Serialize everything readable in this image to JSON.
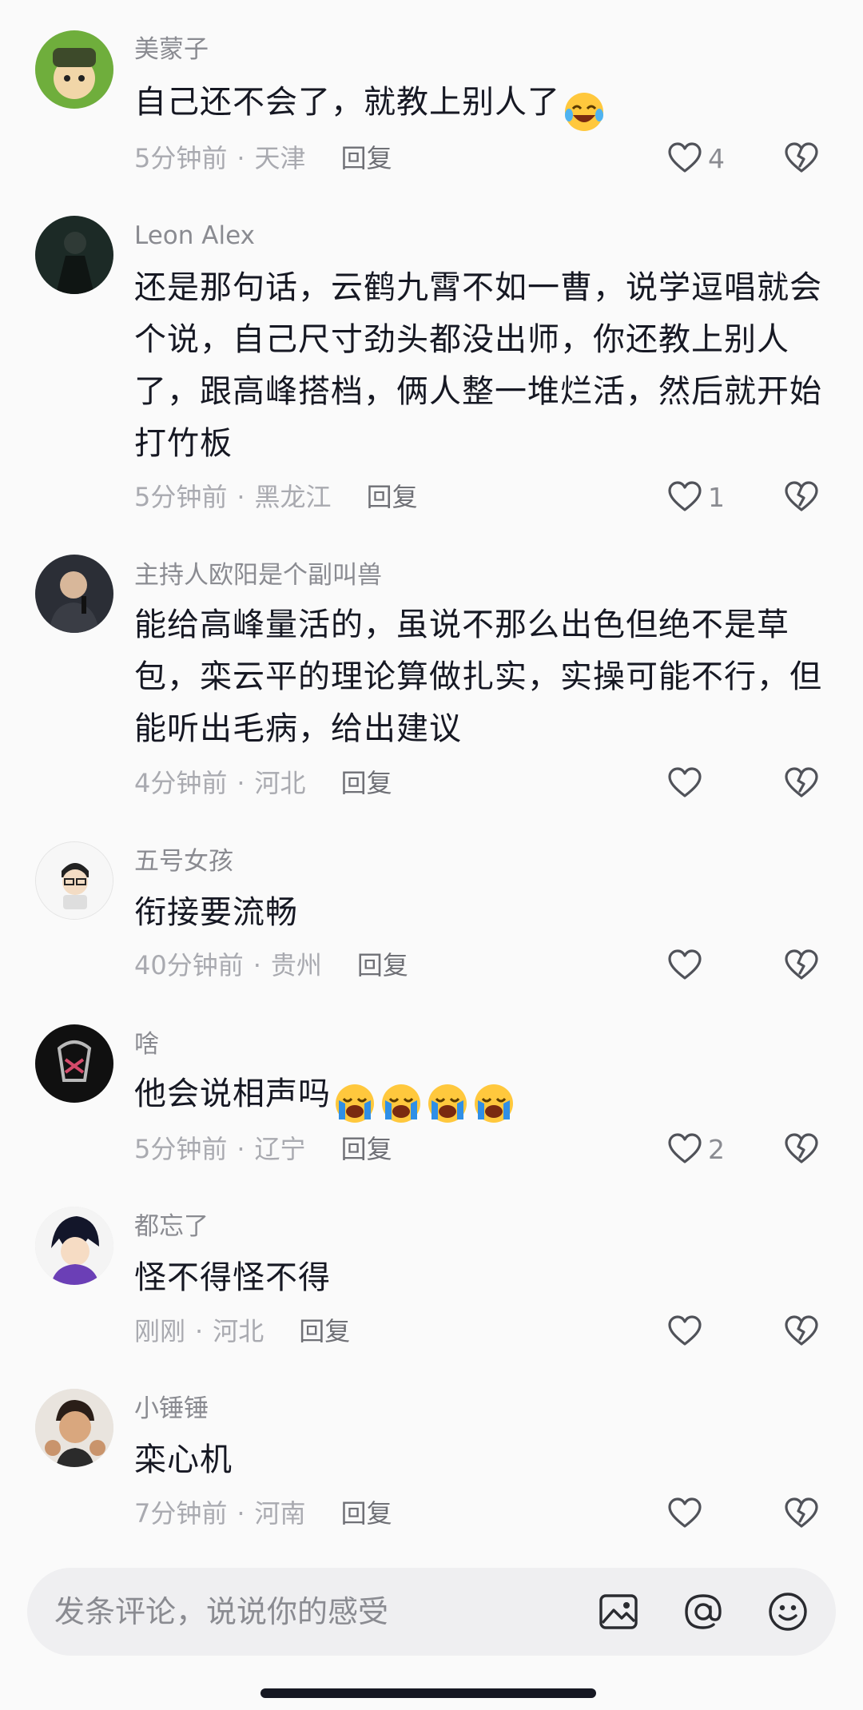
{
  "comments": [
    {
      "username": "美蒙子",
      "lines": [
        "自己还不会了，就教上别人了"
      ],
      "emoji_count": 1,
      "time": "5分钟前",
      "location": "天津",
      "reply": "回复",
      "likes": "4"
    },
    {
      "username": "Leon Alex",
      "lines": [
        "还是那句话，云鹤九霄不如一曹，说学逗唱就会",
        "个说，自己尺寸劲头都没出师，你还教上别人",
        "了，跟高峰搭档，俩人整一堆烂活，然后就开始",
        "打竹板"
      ],
      "emoji_count": 0,
      "time": "5分钟前",
      "location": "黑龙江",
      "reply": "回复",
      "likes": "1"
    },
    {
      "username": "主持人欧阳是个副叫兽",
      "lines": [
        "能给高峰量活的，虽说不那么出色但绝不是草",
        "包，栾云平的理论算做扎实，实操可能不行，但",
        "能听出毛病，给出建议"
      ],
      "emoji_count": 0,
      "time": "4分钟前",
      "location": "河北",
      "reply": "回复",
      "likes": ""
    },
    {
      "username": "五号女孩",
      "lines": [
        "衔接要流畅"
      ],
      "emoji_count": 0,
      "time": "40分钟前",
      "location": "贵州",
      "reply": "回复",
      "likes": ""
    },
    {
      "username": "啥",
      "lines": [
        "他会说相声吗"
      ],
      "emoji_count": 4,
      "time": "5分钟前",
      "location": "辽宁",
      "reply": "回复",
      "likes": "2"
    },
    {
      "username": "都忘了",
      "lines": [
        "怪不得怪不得"
      ],
      "emoji_count": 0,
      "time": "刚刚",
      "location": "河北",
      "reply": "回复",
      "likes": ""
    },
    {
      "username": "小锤锤",
      "lines": [
        "栾心机"
      ],
      "emoji_count": 0,
      "time": "7分钟前",
      "location": "河南",
      "reply": "回复",
      "likes": ""
    }
  ],
  "input_bar": {
    "placeholder": "发条评论，说说你的感受",
    "icons": [
      "image-icon",
      "at-mention-icon",
      "emoji-icon"
    ]
  },
  "colors": {
    "background": "#fafafa",
    "primary_text": "#161823",
    "secondary_text": "#8a8b91",
    "meta_text": "#a9aab0",
    "input_background": "#efeff1"
  }
}
